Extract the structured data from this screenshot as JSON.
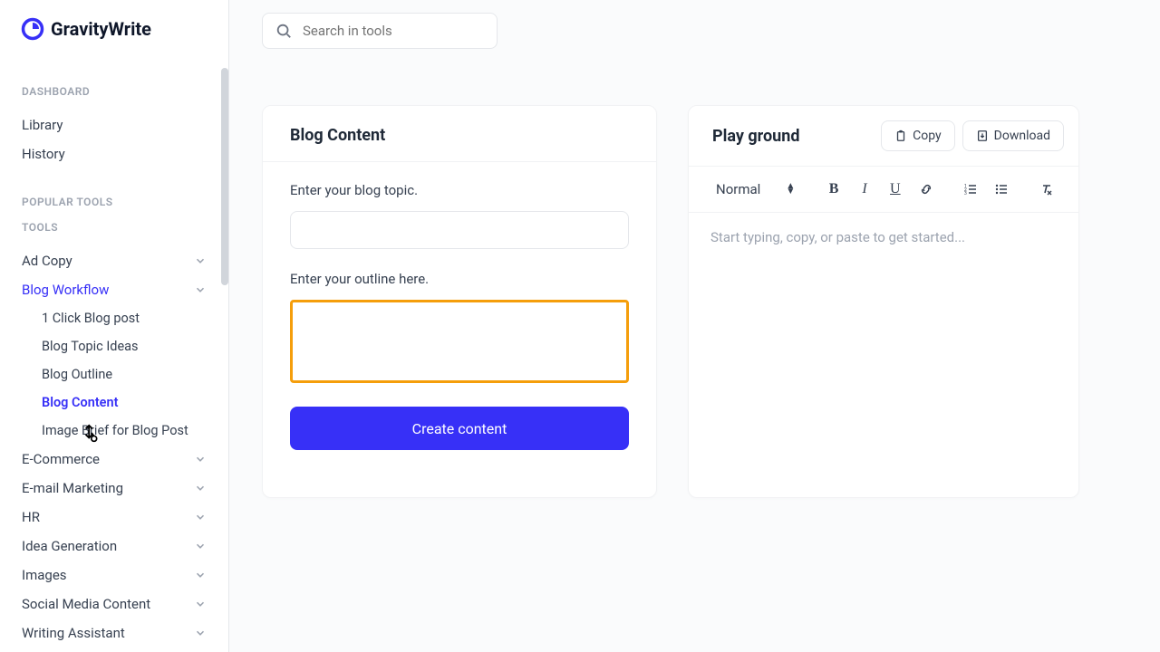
{
  "brand": "GravityWrite",
  "search": {
    "placeholder": "Search in tools"
  },
  "sidebar": {
    "dashboard_label": "DASHBOARD",
    "dashboard_items": [
      "Library",
      "History"
    ],
    "popular_label": "POPULAR TOOLS",
    "tools_label": "TOOLS",
    "tools": [
      {
        "label": "Ad Copy",
        "expandable": true
      },
      {
        "label": "Blog Workflow",
        "expandable": true,
        "open": true,
        "active_group": true,
        "children": [
          "1 Click Blog post",
          "Blog Topic Ideas",
          "Blog Outline",
          "Blog Content",
          "Image Brief for Blog Post"
        ],
        "active_child": "Blog Content"
      },
      {
        "label": "E-Commerce",
        "expandable": true
      },
      {
        "label": "E-mail Marketing",
        "expandable": true
      },
      {
        "label": "HR",
        "expandable": true
      },
      {
        "label": "Idea Generation",
        "expandable": true
      },
      {
        "label": "Images",
        "expandable": true
      },
      {
        "label": "Social Media Content",
        "expandable": true
      },
      {
        "label": "Writing Assistant",
        "expandable": true
      }
    ]
  },
  "form": {
    "title": "Blog Content",
    "topic_label": "Enter your blog topic.",
    "outline_label": "Enter your outline here.",
    "submit": "Create content"
  },
  "playground": {
    "title": "Play ground",
    "copy": "Copy",
    "download": "Download",
    "style_select": "Normal",
    "placeholder": "Start typing, copy, or paste to get started..."
  }
}
